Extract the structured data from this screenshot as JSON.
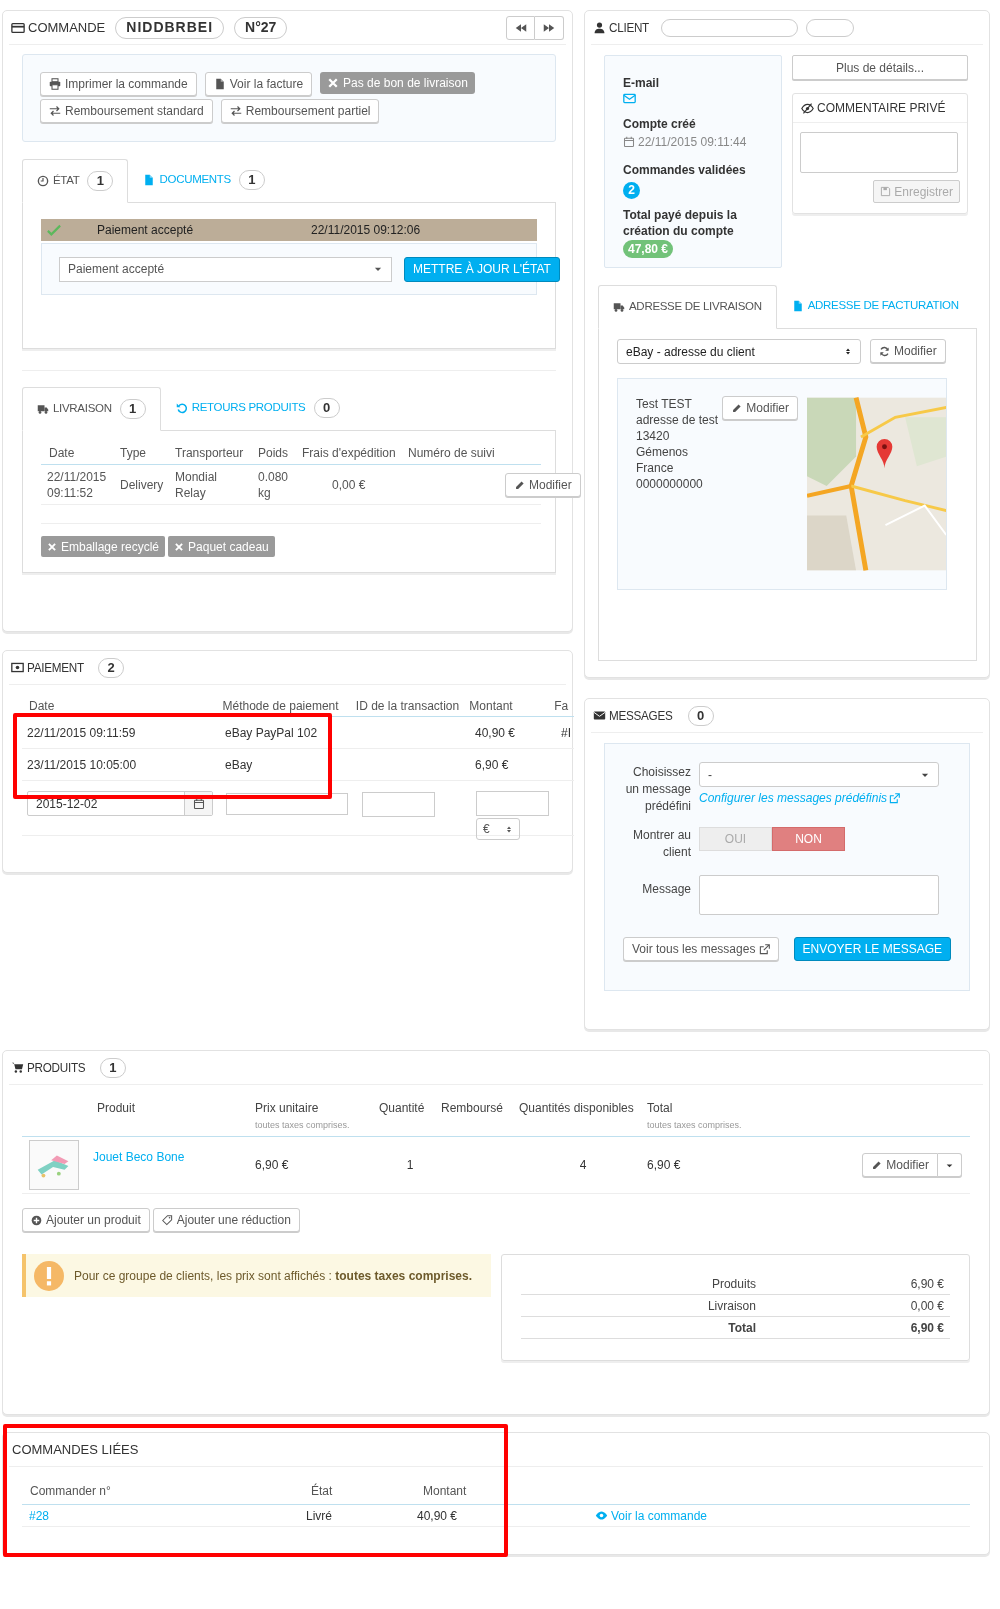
{
  "order": {
    "title": "COMMANDE",
    "reference": "NIDDBRBEI",
    "number": "N°27",
    "actions": [
      {
        "label": "Imprimer la commande",
        "kind": "print",
        "disabled": false
      },
      {
        "label": "Voir la facture",
        "kind": "file",
        "disabled": false
      },
      {
        "label": "Pas de bon de livraison",
        "kind": "x",
        "disabled": true
      },
      {
        "label": "Remboursement standard",
        "kind": "exchange",
        "disabled": false
      },
      {
        "label": "Remboursement partiel",
        "kind": "exchange",
        "disabled": false
      }
    ],
    "status_tabs": [
      {
        "label": "ÉTAT",
        "count": "1",
        "kind": "clock",
        "selected": true
      },
      {
        "label": "DOCUMENTS",
        "count": "1",
        "kind": "file",
        "selected": false
      }
    ],
    "history": [
      {
        "status": "Paiement accepté",
        "date": "22/11/2015 09:12:06"
      }
    ],
    "status_select": "Paiement accepté",
    "update_button": "METTRE À JOUR L'ÉTAT",
    "shipping_tabs": [
      {
        "label": "LIVRAISON",
        "count": "1",
        "kind": "truck",
        "selected": true
      },
      {
        "label": "RETOURS PRODUITS",
        "count": "0",
        "kind": "undo",
        "selected": false
      }
    ],
    "shipping_columns": [
      "Date",
      "Type",
      "Transporteur",
      "Poids",
      "Frais d'expédition",
      "Numéro de suivi"
    ],
    "shipping_rows": [
      {
        "date": "22/11/2015 09:11:52",
        "type": "Delivery",
        "carrier": "Mondial Relay",
        "weight": "0.080 kg",
        "cost": "0,00 €",
        "button": "Modifier"
      }
    ],
    "options": [
      {
        "label": "Emballage recyclé",
        "enabled": false
      },
      {
        "label": "Paquet cadeau",
        "enabled": false
      }
    ]
  },
  "client": {
    "title": "CLIENT",
    "email_label": "E-mail",
    "created_label": "Compte créé",
    "created": "22/11/2015 09:11:44",
    "orders_label": "Commandes validées",
    "orders_count": "2",
    "total_label": "Total payé depuis la création du compte",
    "total": "47,80 €",
    "details_button": "Plus de détails...",
    "comment_title": "COMMENTAIRE PRIVÉ",
    "save_button": "Enregistrer",
    "address_tabs": [
      {
        "label": "ADRESSE DE LIVRAISON",
        "kind": "truck",
        "selected": true
      },
      {
        "label": "ADRESSE DE FACTURATION",
        "kind": "file",
        "selected": false
      }
    ],
    "address_select": "eBay - adresse du client",
    "refresh_button": "Modifier",
    "edit_button": "Modifier",
    "address_lines": [
      "Test TEST",
      "adresse de test",
      "13420 Gémenos",
      "France",
      "0000000000"
    ]
  },
  "payment": {
    "title": "PAIEMENT",
    "count": "2",
    "highlighted": true,
    "columns": [
      "Date",
      "Méthode de paiement",
      "ID de la transaction",
      "Montant",
      "Fa"
    ],
    "rows": [
      {
        "date": "22/11/2015 09:11:59",
        "method": "eBay PayPal 102",
        "amount": "40,90 €",
        "column_5": "#I"
      },
      {
        "date": "23/11/2015 10:05:00",
        "method": "eBay",
        "amount": "6,90 €"
      }
    ],
    "new_date": "2015-12-02",
    "currency": "€"
  },
  "messages": {
    "title": "MESSAGES",
    "count": "0",
    "choose_label": "Choisissez un message prédéfini",
    "choose_value": "-",
    "configure_link": "Configurer les messages prédéfinis",
    "show_label": "Montrer au client",
    "toggle": [
      {
        "label": "OUI",
        "selected": false
      },
      {
        "label": "NON",
        "selected": true
      }
    ],
    "message_label": "Message",
    "view_all": "Voir tous les messages",
    "send": "ENVOYER LE MESSAGE"
  },
  "products": {
    "title": "PRODUITS",
    "count": "1",
    "columns": [
      {
        "label": "Produit"
      },
      {
        "label": "Prix unitaire",
        "note": "toutes taxes comprises."
      },
      {
        "label": "Quantité"
      },
      {
        "label": "Remboursé"
      },
      {
        "label": "Quantités disponibles"
      },
      {
        "label": "Total",
        "note": "toutes taxes comprises."
      }
    ],
    "rows": [
      {
        "name": "Jouet Beco Bone",
        "unit_price": "6,90 €",
        "quantity": "1",
        "available": "4",
        "total": "6,90 €",
        "button": "Modifier"
      }
    ],
    "add_product": "Ajouter un produit",
    "add_discount": "Ajouter une réduction",
    "notice": "Pour ce groupe de clients, les prix sont affichés : **toutes taxes comprises.**",
    "totals": [
      {
        "label": "Produits",
        "value": "6,90 €",
        "bold": false
      },
      {
        "label": "Livraison",
        "value": "0,00 €",
        "bold": false
      },
      {
        "label": "Total",
        "value": "6,90 €",
        "bold": true
      }
    ]
  },
  "linked_orders": {
    "title": "COMMANDES LIÉES",
    "highlighted": true,
    "columns": [
      "Commander n°",
      "État",
      "Montant"
    ],
    "rows": [
      {
        "order": "#28",
        "status": "Livré",
        "amount": "40,90 €",
        "link": "Voir la commande"
      }
    ]
  }
}
